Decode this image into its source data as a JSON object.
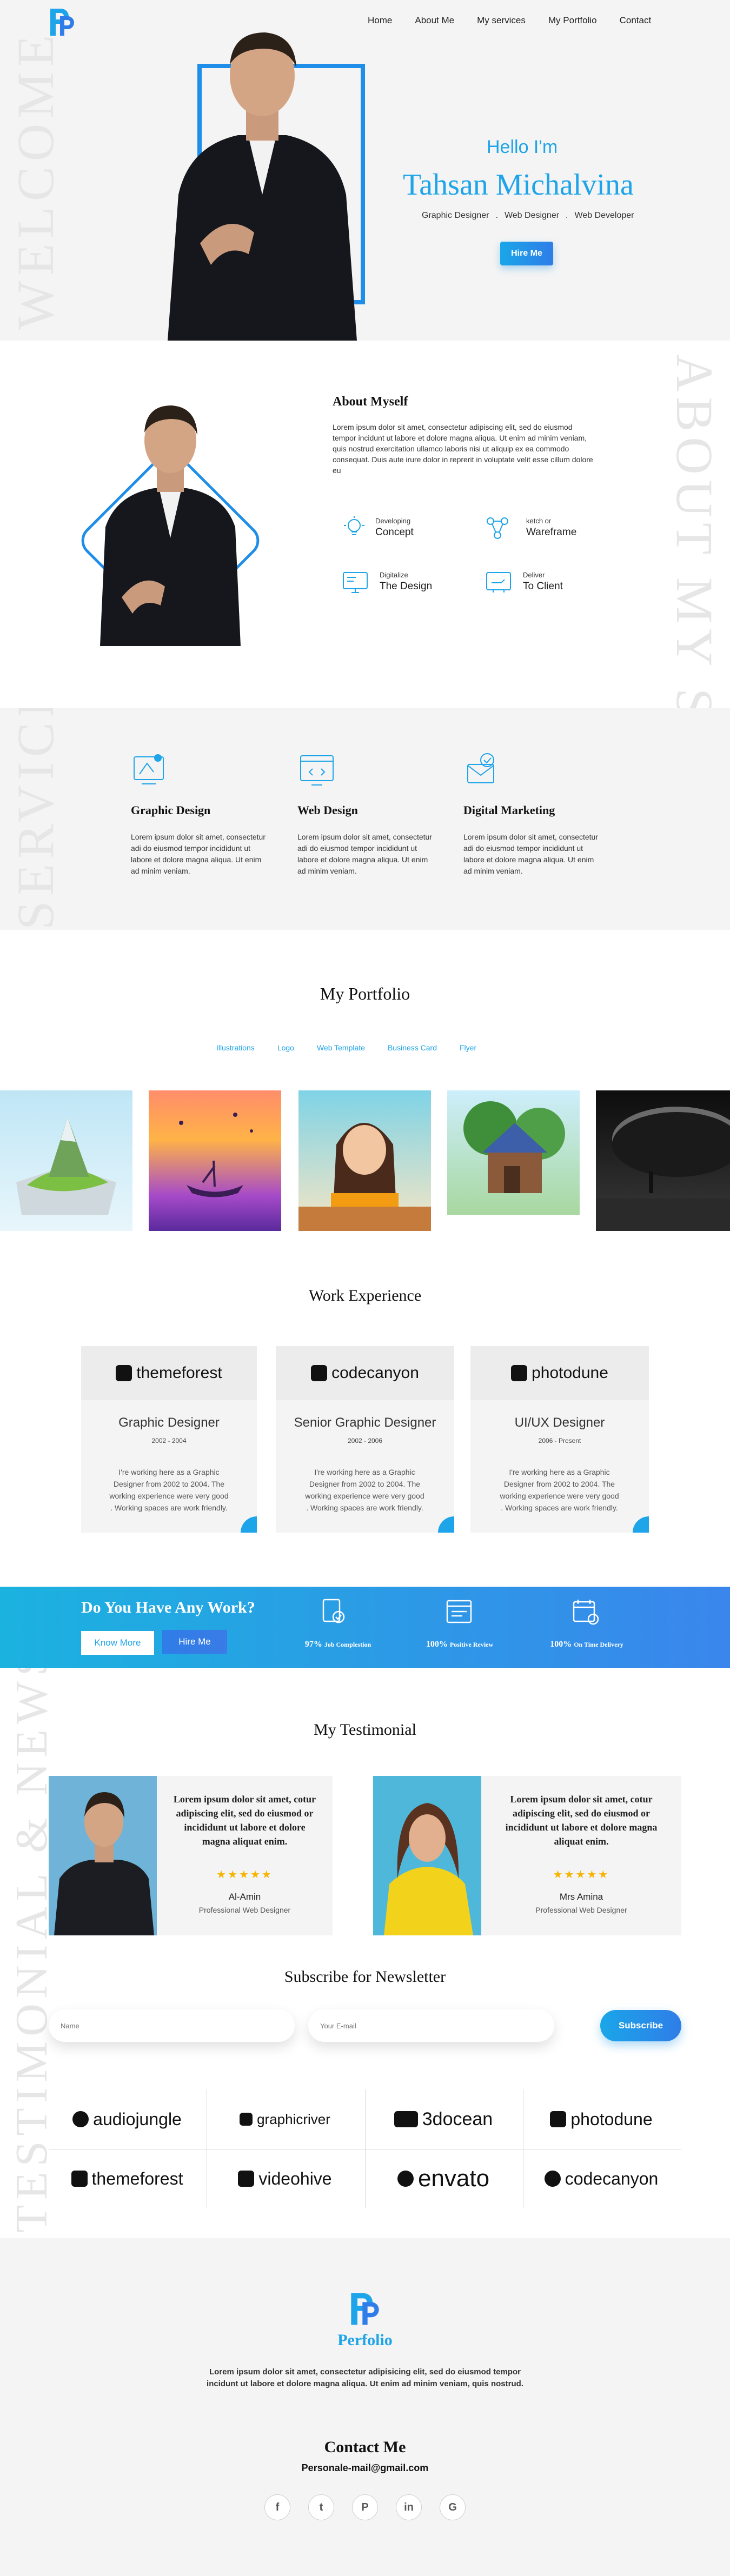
{
  "nav": {
    "items": [
      "Home",
      "About Me",
      "My services",
      "My Portfolio",
      "Contact"
    ]
  },
  "hero": {
    "vertical_text": "WELCOME",
    "greeting": "Hello I'm",
    "name": "Tahsan Michalvina",
    "roles": [
      "Graphic Designer",
      "Web Designer",
      "Web Developer"
    ],
    "button": "Hire Me"
  },
  "about": {
    "vertical_text": "ABOUT MY SELF",
    "title": "About Myself",
    "text": "Lorem ipsum dolor sit amet, consectetur adipiscing elit, sed do eiusmod tempor incidunt ut labore et dolore magna aliqua. Ut enim ad minim veniam, quis nostrud exercitation ullamco laboris nisi ut aliquip ex ea commodo consequat. Duis aute irure dolor in reprerit in voluptate velit esse cillum dolore eu",
    "features": [
      {
        "small": "Developing",
        "big": "Concept",
        "icon": "bulb-icon"
      },
      {
        "small": "ketch or",
        "big": "Wareframe",
        "icon": "wireframe-icon"
      },
      {
        "small": "Digitalize",
        "big": "The Design",
        "icon": "monitor-icon"
      },
      {
        "small": "Deliver",
        "big": "To Client",
        "icon": "delivery-icon"
      }
    ]
  },
  "services": {
    "vertical_text": "SERVICE",
    "items": [
      {
        "title": "Graphic Design",
        "text": "Lorem ipsum dolor sit amet, consectetur adi do eiusmod tempor incididunt ut labore et dolore magna aliqua. Ut enim ad minim veniam.",
        "icon": "graphic-design-icon"
      },
      {
        "title": "Web Design",
        "text": "Lorem ipsum dolor sit amet, consectetur adi do eiusmod tempor incididunt ut labore et dolore magna aliqua. Ut enim ad minim veniam.",
        "icon": "web-design-icon"
      },
      {
        "title": "Digital Marketing",
        "text": "Lorem ipsum dolor sit amet, consectetur adi do eiusmod tempor incididunt ut labore et dolore magna aliqua. Ut enim ad minim veniam.",
        "icon": "digital-marketing-icon"
      }
    ]
  },
  "portfolio": {
    "title": "My Portfolio",
    "filters": [
      "Illustrations",
      "Logo",
      "Web Template",
      "Business Card",
      "Flyer"
    ]
  },
  "experience": {
    "title": "Work Experience",
    "items": [
      {
        "brand": "themeforest",
        "role": "Graphic Designer",
        "years": "2002 - 2004",
        "text": "I're working here as a Graphic Designer from 2002 to 2004. The working experience were very good . Working spaces are work friendly."
      },
      {
        "brand": "codecanyon",
        "role": "Senior Graphic Designer",
        "years": "2002 - 2006",
        "text": "I're working here as a Graphic Designer from 2002 to 2004. The working experience were very good . Working spaces are work friendly."
      },
      {
        "brand": "photodune",
        "role": "UI/UX Designer",
        "years": "2006 - Present",
        "text": "I're working here as a Graphic Designer from 2002 to 2004. The working experience were very good . Working spaces are work friendly."
      }
    ]
  },
  "cta": {
    "title": "Do You Have Any Work?",
    "know_more": "Know More",
    "hire_me": "Hire Me",
    "stats": [
      {
        "strong": "97%",
        "label": "Job Complestion"
      },
      {
        "strong": "100%",
        "label": "Positive Review"
      },
      {
        "strong": "100%",
        "label": "On Time Delivery"
      }
    ]
  },
  "testimonial": {
    "vertical_text": "TESTIMONIAL & NEWSLETTER",
    "title": "My Testimonial",
    "items": [
      {
        "text": "Lorem ipsum dolor sit amet, cotur adipiscing elit, sed do eiusmod or incididunt ut labore et dolore magna aliquat enim.",
        "stars": "★★★★★",
        "name": "Al-Amin",
        "role": "Professional Web Designer"
      },
      {
        "text": "Lorem ipsum dolor sit amet, cotur adipiscing elit, sed do eiusmod or incididunt ut labore et dolore magna aliquat enim.",
        "stars": "★★★★★",
        "name": "Mrs Amina",
        "role": "Professional Web Designer"
      }
    ]
  },
  "newsletter": {
    "title": "Subscribe for Newsletter",
    "name_placeholder": "Name",
    "email_placeholder": "Your E-mail",
    "button": "Subscribe"
  },
  "brands": [
    "audiojungle",
    "graphicriver",
    "3docean",
    "photodune",
    "themeforest",
    "videohive",
    "envato",
    "codecanyon"
  ],
  "footer": {
    "logo_text": "Perfolio",
    "text": "Lorem ipsum dolor sit amet, consectetur adipisicing elit, sed do eiusmod tempor incidunt ut labore et dolore magna aliqua. Ut enim ad minim veniam, quis nostrud.",
    "contact_title": "Contact Me",
    "email": "Personale-mail@gmail.com",
    "socials": [
      "f",
      "t",
      "P",
      "in",
      "G"
    ]
  },
  "colors": {
    "accent": "#1ea4e9",
    "accent2": "#2f7de8",
    "light_bg": "#f4f4f4"
  }
}
